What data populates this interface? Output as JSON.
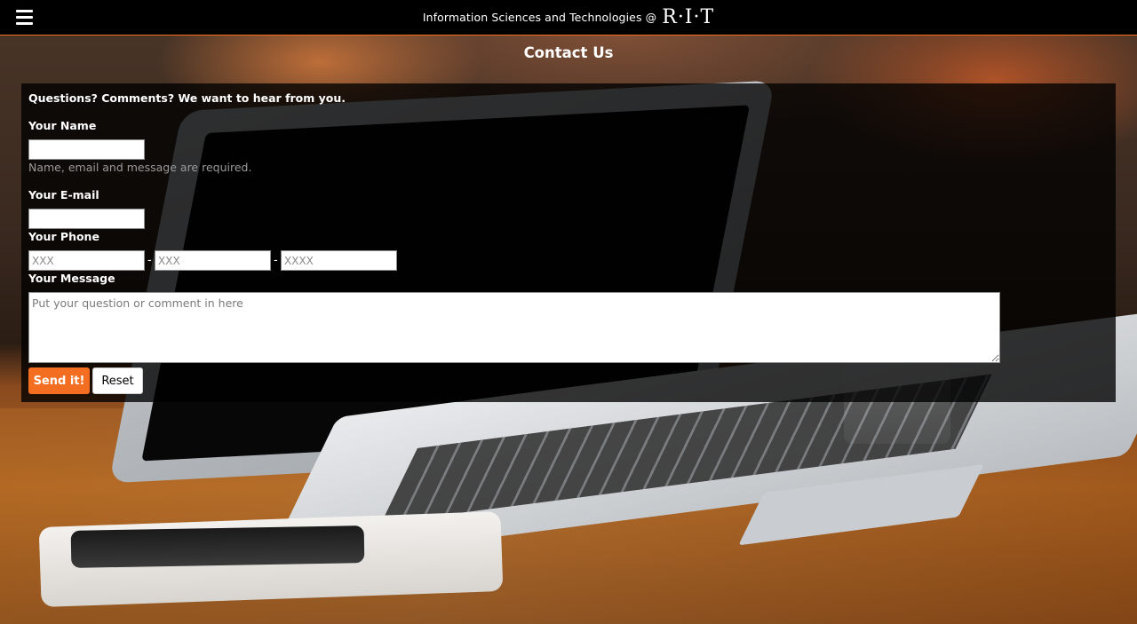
{
  "header": {
    "brand_text": "Information Sciences and Technologies @",
    "brand_logo": "R·I·T",
    "menu_icon": "hamburger-menu-icon",
    "accent_color": "#f36e21"
  },
  "page": {
    "title": "Contact Us"
  },
  "form": {
    "intro": "Questions? Comments? We want to hear from you.",
    "name_label": "Your Name",
    "name_value": "",
    "required_hint": "Name, email and message are required.",
    "email_label": "Your E-mail",
    "email_value": "",
    "phone_label": "Your Phone",
    "phone_area_placeholder": "XXX",
    "phone_prefix_placeholder": "XXX",
    "phone_line_placeholder": "XXXX",
    "phone_separator": "-",
    "message_label": "Your Message",
    "message_placeholder": "Put your question or comment in here",
    "send_label": "Send it!",
    "reset_label": "Reset"
  }
}
